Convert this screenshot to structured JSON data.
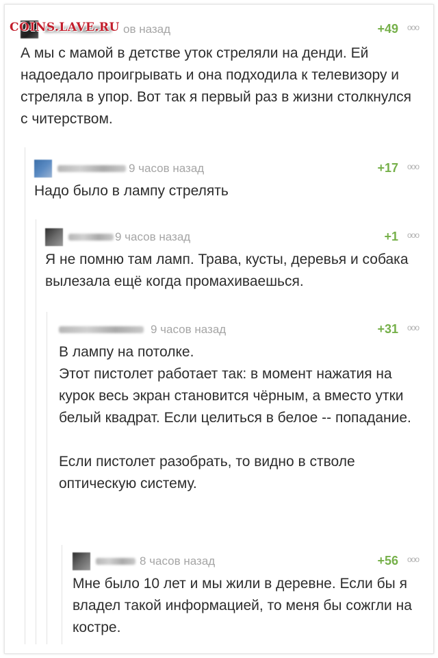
{
  "watermark": "COINS.LAVE.RU",
  "comments": [
    {
      "time": "10 часов назад",
      "time_visible": "ов назад",
      "score": "+49",
      "dots": "ooo",
      "text": "А мы с мамой в детстве уток стреляли на денди. Ей надоедало проигрывать и она подходила к телевизору и стреляла в упор. Вот так я первый раз в жизни столкнулся с читерством."
    },
    {
      "time": "9 часов назад",
      "score": "+17",
      "dots": "ooo",
      "text": "Надо было в лампу стрелять"
    },
    {
      "time": "9 часов назад",
      "score": "+1",
      "dots": "ooo",
      "text": "Я не помню там ламп. Трава, кусты, деревья и собака вылезала ещё когда промахиваешься."
    },
    {
      "time": "9 часов назад",
      "score": "+31",
      "dots": "ooo",
      "text": "В лампу на потолке.\nЭтот пистолет работает так: в момент нажатия на курок весь экран становится чёрным, а вместо утки белый квадрат. Если целиться в белое -- попадание.\n\nЕсли пистолет разобрать, то видно в стволе оптическую систему."
    },
    {
      "time": "8 часов назад",
      "score": "+56",
      "dots": "ooo",
      "text": "Мне было 10 лет и мы жили в деревне. Если бы я владел такой информацией, то меня бы сожгли на костре."
    }
  ],
  "colors": {
    "score": "#76b04a",
    "time": "#a5a5a5",
    "text": "#2d2d2d",
    "watermark": "#c21d2b"
  }
}
